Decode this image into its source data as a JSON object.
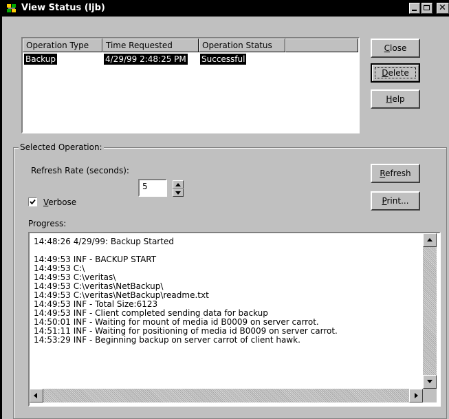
{
  "window": {
    "title": "View Status (ljb)",
    "icon": "veritas-app-icon"
  },
  "titlebar_buttons": [
    "minimize-icon",
    "maximize-icon",
    "close-icon"
  ],
  "operations": {
    "columns": [
      "Operation Type",
      "Time Requested",
      "Operation Status"
    ],
    "rows": [
      {
        "type": "Backup",
        "time": "4/29/99 2:48:25 PM",
        "status": "Successful",
        "selected": true
      }
    ]
  },
  "buttons": {
    "close": "Close",
    "delete": "Delete",
    "help": "Help",
    "refresh": "Refresh",
    "print": "Print..."
  },
  "selected_operation": {
    "group_label": "Selected Operation:",
    "refresh_rate_label": "Refresh Rate (seconds):",
    "refresh_rate_value": "5",
    "verbose_label": "Verbose",
    "verbose_checked": true,
    "progress_label": "Progress:"
  },
  "progress_log": [
    "14:48:26 4/29/99: Backup Started",
    "",
    "14:49:53 INF - BACKUP START",
    "14:49:53 C:\\",
    "14:49:53 C:\\veritas\\",
    "14:49:53 C:\\veritas\\NetBackup\\",
    "14:49:53 C:\\veritas\\NetBackup\\readme.txt",
    "14:49:53 INF - Total Size:6123",
    "14:49:53 INF - Client completed sending data for backup",
    "14:50:01 INF - Waiting for mount of media id B0009 on server carrot.",
    "14:51:11 INF - Waiting for positioning of media id B0009 on server carrot.",
    "14:53:29 INF - Beginning backup on server carrot of client hawk."
  ],
  "colors": {
    "face": "#c0c0c0",
    "titlebar": "#000000",
    "selection": "#000000"
  }
}
